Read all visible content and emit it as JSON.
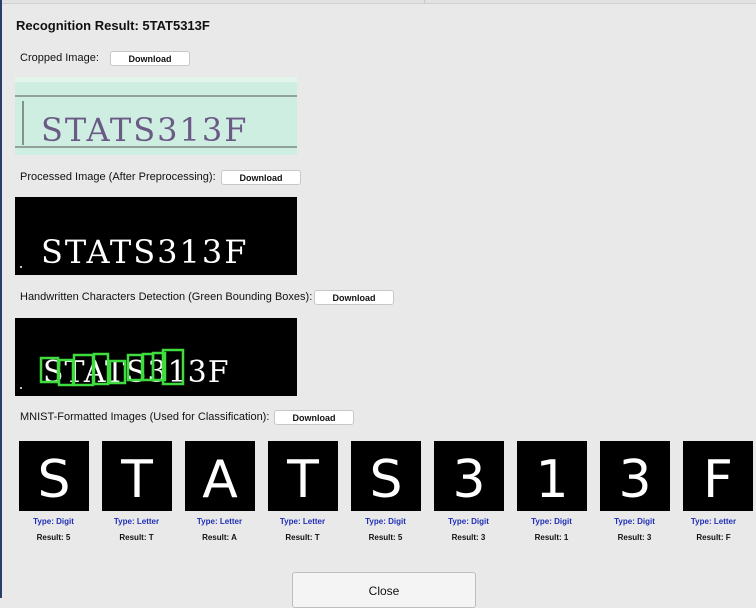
{
  "dialog": {
    "title": "Recognition Result: 5TAT5313F",
    "close_label": "Close"
  },
  "sections": {
    "cropped": {
      "label": "Cropped Image:",
      "download": "Download",
      "image_text": "STATS313F"
    },
    "processed": {
      "label": "Processed Image (After Preprocessing):",
      "download": "Download",
      "image_text": "STATS313F"
    },
    "detection": {
      "label": "Handwritten Characters Detection (Green Bounding Boxes):",
      "download": "Download",
      "image_text": "STATS313F"
    },
    "mnist": {
      "label": "MNIST-Formatted Images (Used for Classification):",
      "download": "Download"
    }
  },
  "characters": [
    {
      "glyph": "S",
      "type": "Type: Digit",
      "result": "Result: 5"
    },
    {
      "glyph": "T",
      "type": "Type: Letter",
      "result": "Result: T"
    },
    {
      "glyph": "A",
      "type": "Type: Letter",
      "result": "Result: A"
    },
    {
      "glyph": "T",
      "type": "Type: Letter",
      "result": "Result: T"
    },
    {
      "glyph": "S",
      "type": "Type: Digit",
      "result": "Result: 5"
    },
    {
      "glyph": "3",
      "type": "Type: Digit",
      "result": "Result: 3"
    },
    {
      "glyph": "1",
      "type": "Type: Digit",
      "result": "Result: 1"
    },
    {
      "glyph": "3",
      "type": "Type: Digit",
      "result": "Result: 3"
    },
    {
      "glyph": "F",
      "type": "Type: Letter",
      "result": "Result: F"
    }
  ],
  "colors": {
    "type_label": "#1f2fb6",
    "bbox_green": "#3fdc3f",
    "cropped_bg": "#cdeee0",
    "ink": "#6b5a86"
  }
}
